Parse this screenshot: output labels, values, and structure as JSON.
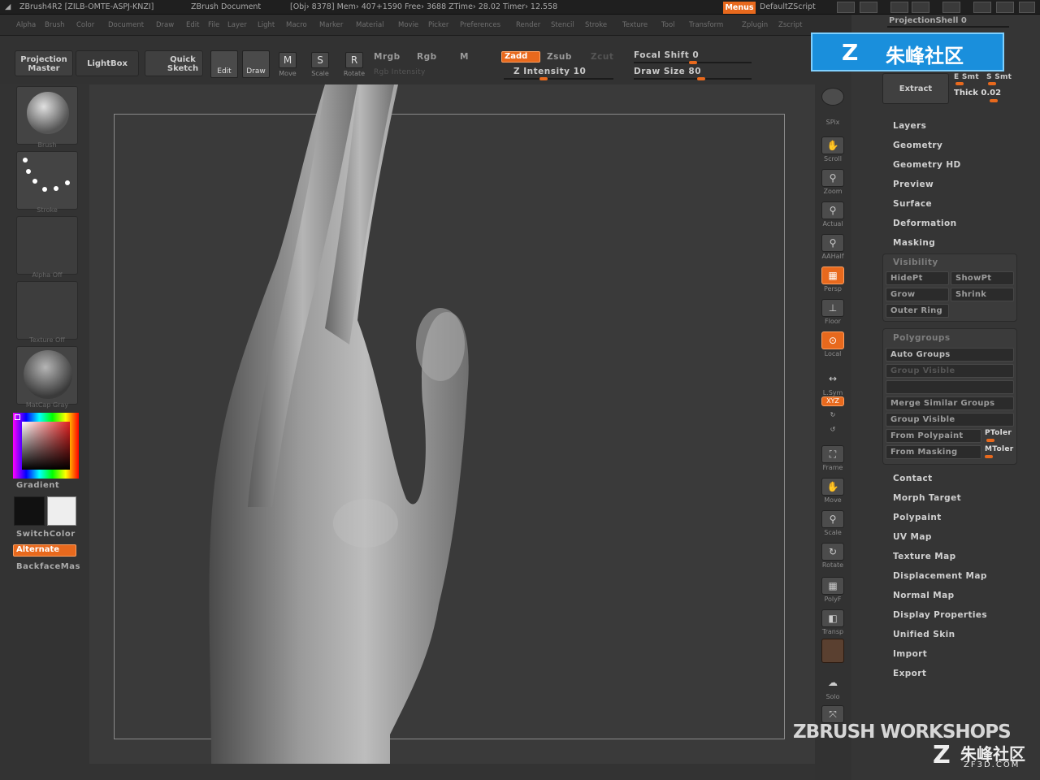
{
  "titlebar": {
    "app": "ZBrush4R2 [ZILB-OMTE-ASPJ-KNZI]",
    "document": "ZBrush Document",
    "stats": "[Obj› 8378] Mem› 407+1590 Free› 3688 ZTime› 28.02 Timer› 12.558",
    "menus_label": "Menus",
    "script_label": "DefaultZScript"
  },
  "menubar": {
    "items": [
      "Alpha",
      "Brush",
      "Color",
      "Document",
      "Draw",
      "Edit",
      "File",
      "Layer",
      "Light",
      "Macro",
      "Marker",
      "Material",
      "Movie",
      "Picker",
      "Preferences",
      "Render",
      "Stencil",
      "Stroke",
      "Texture",
      "Tool",
      "Transform",
      "Zplugin",
      "Zscript"
    ]
  },
  "toolbar": {
    "projection_master": "Projection Master",
    "lightbox": "LightBox",
    "quick_sketch": "Quick Sketch",
    "edit": "Edit",
    "draw": "Draw",
    "move": "Move",
    "scale": "Scale",
    "rotate": "Rotate",
    "mrgb": "Mrgb",
    "rgb": "Rgb",
    "m": "M",
    "zadd": "Zadd",
    "zsub": "Zsub",
    "zcut": "Zcut",
    "rgb_intensity": "Rgb Intensity",
    "z_intensity": "Z Intensity 10",
    "focal_shift": "Focal Shift 0",
    "draw_size": "Draw Size 80"
  },
  "leftpanel": {
    "brush_caption": "Brush",
    "stroke_caption": "Stroke",
    "alpha_caption": "Alpha Off",
    "texture_caption": "Texture Off",
    "material_caption": "MatCap Gray",
    "gradient": "Gradient",
    "switchcolor": "SwitchColor",
    "alternate": "Alternate",
    "backfacemask": "BackfaceMas"
  },
  "shelf": {
    "items": [
      "SPix",
      "Scroll",
      "Zoom",
      "Actual",
      "AAHalf",
      "Persp",
      "Floor",
      "Local",
      "L.Sym",
      "XYZ",
      "Frame",
      "Move",
      "Scale",
      "Rotate",
      "PolyF",
      "Transp",
      "Solo"
    ]
  },
  "rpanel": {
    "projection_shell": "ProjectionShell 0",
    "extract": "Extract",
    "e_smt": "E Smt",
    "s_smt": "S Smt",
    "thick": "Thick 0.02",
    "items_top": [
      "Layers",
      "Geometry",
      "Geometry HD",
      "Preview",
      "Surface",
      "Deformation",
      "Masking"
    ],
    "visibility_head": "Visibility",
    "hidept": "HidePt",
    "showpt": "ShowPt",
    "grow": "Grow",
    "shrink": "Shrink",
    "outer_ring": "Outer Ring",
    "polygroups_head": "Polygroups",
    "auto_groups": "Auto Groups",
    "group_visible": "Group Visible",
    "merge_similar": "Merge Similar Groups",
    "group_visible2": "Group Visible",
    "from_polypaint": "From Polypaint",
    "ptolerance": "PToler",
    "from_masking": "From Masking",
    "mtolerance": "MToler",
    "items_bottom": [
      "Contact",
      "Morph Target",
      "Polypaint",
      "UV Map",
      "Texture Map",
      "Displacement Map",
      "Normal Map",
      "Display Properties",
      "Unified Skin",
      "Import",
      "Export"
    ]
  },
  "watermark": {
    "top": "朱峰社区",
    "workshops": "ZBRUSH WORKSHOPS",
    "bottom": "朱峰社区",
    "bottom_url": "ZF3D.COM"
  },
  "colors": {
    "accent": "#e8691d",
    "panel": "#353535",
    "canvas": "#3a3a3a"
  }
}
